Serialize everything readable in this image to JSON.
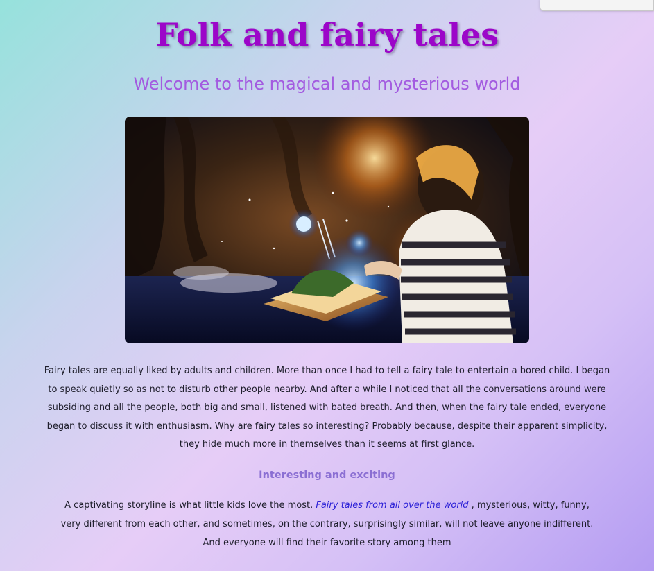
{
  "header": {
    "title": "Folk and fairy tales",
    "subtitle": "Welcome to the magical and mysterious world"
  },
  "hero_image": {
    "alt": "A child opening a glowing magical book in a dark enchanted forest"
  },
  "intro": {
    "text": "Fairy tales are equally liked by adults and children. More than once I had to tell a fairy tale to entertain a bored child. I began to speak quietly so as not to disturb other people nearby. And after a while I noticed that all the conversations around were subsiding and all the people, both big and small, listened with bated breath. And then, when the fairy tale ended, everyone began to discuss it with enthusiasm. Why are fairy tales so interesting? Probably because, despite their apparent simplicity, they hide much more in themselves than it seems at first glance."
  },
  "section": {
    "heading": "Interesting and exciting",
    "line1_before": "A captivating storyline is what little kids love the most. ",
    "link_text": "Fairy tales from all over the world",
    "line1_after": " , mysterious, witty, funny,",
    "line2": "very different from each other, and sometimes, on the contrary, surprisingly similar, will not leave anyone indifferent.",
    "line3": "And everyone will find their favorite story among them"
  },
  "colors": {
    "title": "#9c06c9",
    "subtitle": "#a35be0",
    "heading": "#8b6fd3",
    "link": "#2a1fd6"
  }
}
